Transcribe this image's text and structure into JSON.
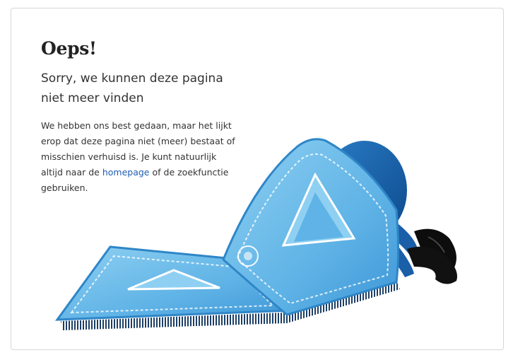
{
  "error": {
    "title": "Oeps!",
    "subtitle": "Sorry, we kunnen deze pagina niet meer vinden",
    "body_before_link": "We hebben ons best gedaan, maar het lijkt erop dat deze pagina niet (meer) bestaat of misschien verhuisd is. Je kunt natuurlijk altijd naar de ",
    "link_label": "homepage",
    "body_after_link": " of de zoekfunctie gebruiken."
  },
  "illustration": {
    "icon": "flying-carpet-character-icon",
    "colors": {
      "carpet": "#5fb3e6",
      "carpet_light": "#8fd0f2",
      "carpet_border": "#2f86c7",
      "character": "#1a5fa8",
      "shoes": "#0d0d0d"
    }
  },
  "colors": {
    "link": "#1f5fb0",
    "text": "#333333",
    "border": "#d6d6d6"
  }
}
